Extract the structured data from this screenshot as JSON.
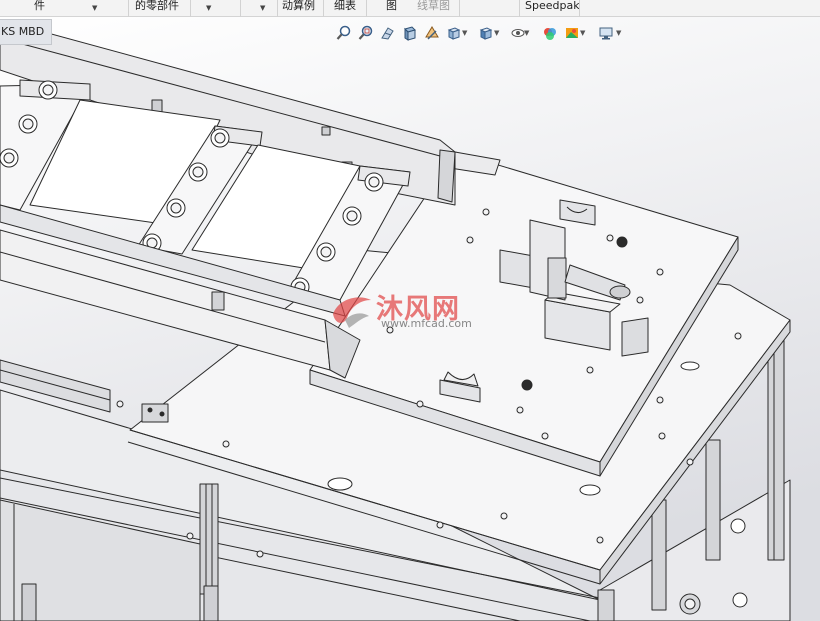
{
  "ribbon": {
    "item_part": "件",
    "item_parts": "的零部件",
    "item_motion": "动算例",
    "item_bom": "细表",
    "item_drawing": "图",
    "item_sketch": "线草图",
    "item_speedpak": "Speedpak"
  },
  "tab": {
    "mbd_label": "KS MBD"
  },
  "view_toolbar": {
    "icons": [
      "zoom-to-fit-icon",
      "zoom-area-icon",
      "previous-view-icon",
      "section-view-icon",
      "dynamic-annotation-icon",
      "view-orientation-icon",
      "display-style-icon",
      "hide-show-items-icon",
      "edit-appearance-icon",
      "apply-scene-icon",
      "view-settings-icon"
    ]
  },
  "colors": {
    "model_line": "#2b2b2b",
    "model_face": "#f4f4f5",
    "model_shade": "#d6d7da",
    "background_top": "#ffffff",
    "background_bottom": "#dcdde2",
    "watermark_red": "#e14646"
  },
  "watermark": {
    "text_cn": "沐风网",
    "text_url": "www.mfcad.com"
  }
}
